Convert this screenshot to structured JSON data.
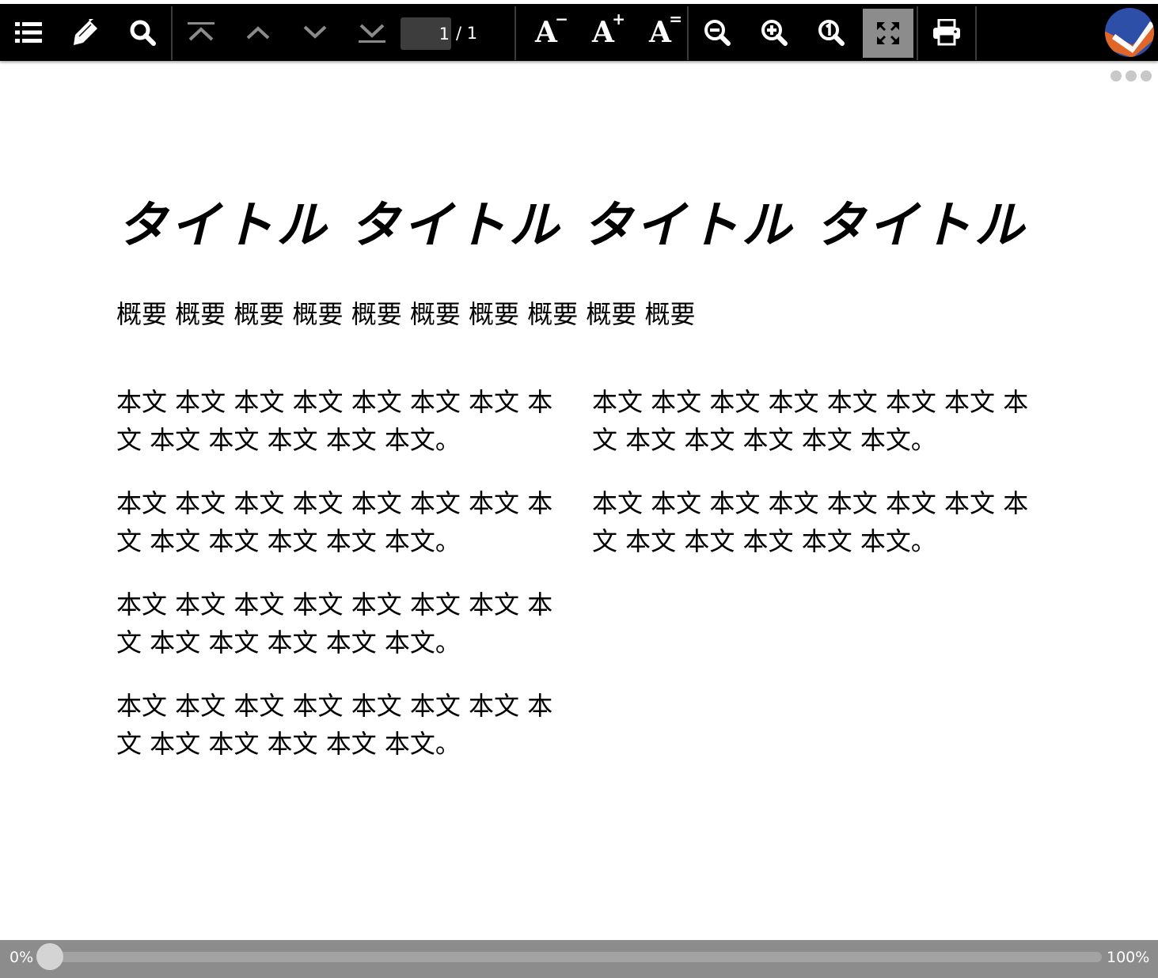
{
  "toolbar": {
    "buttons": {
      "toc": "table-of-contents",
      "annotate": "pen",
      "search": "search",
      "first_page": "first-page",
      "prev_page": "previous-page",
      "next_page": "next-page",
      "last_page": "last-page",
      "zoom_out": "zoom-out",
      "zoom_in": "zoom-in",
      "actual_size": "actual-size",
      "fit_page": "fit-page",
      "print": "print"
    },
    "page_current": "1",
    "page_total": "/ 1",
    "font_decrease": "A",
    "font_decrease_sup": "−",
    "font_increase": "A",
    "font_increase_sup": "+",
    "font_reset": "A",
    "font_reset_sup": "=",
    "active_button": "fit_page"
  },
  "document": {
    "title": "タイトル タイトル タイトル タイトル",
    "summary": "概要 概要 概要 概要 概要 概要 概要 概要 概要 概要",
    "left_column": [
      "本文 本文 本文 本文 本文 本文 本文 本文 本文 本文 本文 本文 本文。",
      "本文 本文 本文 本文 本文 本文 本文 本文 本文 本文 本文 本文 本文。",
      "本文 本文 本文 本文 本文 本文 本文 本文 本文 本文 本文 本文 本文。",
      "本文 本文 本文 本文 本文 本文 本文 本文 本文 本文 本文 本文 本文。"
    ],
    "right_column": [
      "本文 本文 本文 本文 本文 本文 本文 本文 本文 本文 本文 本文 本文。",
      "本文 本文 本文 本文 本文 本文 本文 本文 本文 本文 本文 本文 本文。"
    ]
  },
  "progress": {
    "start_label": "0%",
    "end_label": "100%",
    "value": 0
  },
  "colors": {
    "toolbar_bg": "#000000",
    "active_button_bg": "#8c8c8c",
    "bottom_bar_bg": "#8c8c8c",
    "logo_blue": "#2d4fa8",
    "logo_orange": "#e0662a"
  }
}
